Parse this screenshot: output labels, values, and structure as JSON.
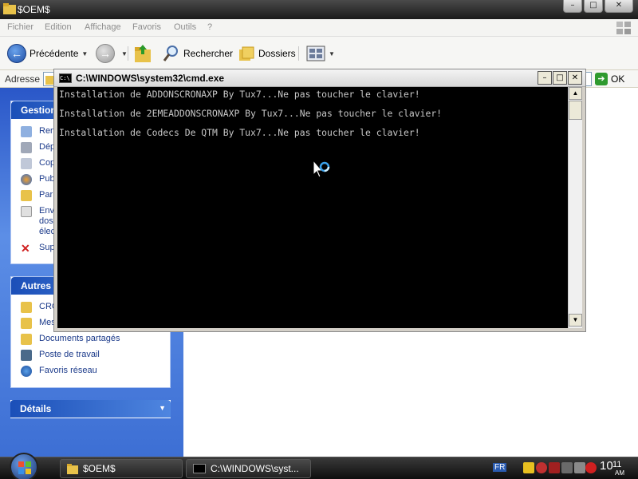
{
  "explorer": {
    "title": "$OEM$",
    "menu": [
      "Fichier",
      "Edition",
      "Affichage",
      "Favoris",
      "Outils",
      "?"
    ],
    "toolbar": {
      "back_label": "Précédente",
      "search_label": "Rechercher",
      "folders_label": "Dossiers"
    },
    "address": {
      "label": "Adresse",
      "go_label": "OK"
    },
    "sidepanel": {
      "box1": {
        "title": "Gestion",
        "items": [
          "Ren",
          "Dép",
          "Cop",
          "Pub",
          "Par",
          "Envoyer ce dossier par courrier électronique",
          "Sup"
        ],
        "item5_lines": [
          "Env",
          "dos",
          "élec"
        ]
      },
      "box2": {
        "title": "Autres",
        "items": [
          "CRO",
          "Mes",
          "Documents partagés",
          "Poste de travail",
          "Favoris réseau"
        ]
      },
      "box3": {
        "title": "Détails"
      }
    }
  },
  "cmd": {
    "title": "C:\\WINDOWS\\system32\\cmd.exe",
    "icon_text": "C:\\",
    "lines": [
      "Installation de ADDONSCRONAXP By Tux7...Ne pas toucher le clavier!",
      "Installation de 2EMEADDONSCRONAXP By Tux7...Ne pas toucher le clavier!",
      "Installation de Codecs De QTM By Tux7...Ne pas toucher le clavier!"
    ]
  },
  "taskbar": {
    "buttons": [
      "$OEM$",
      "C:\\WINDOWS\\syst..."
    ],
    "language": "FR",
    "clock": "10:11",
    "clock_hour": "10",
    "clock_min": "11",
    "ampm": "AM"
  },
  "colors": {
    "cmd_background": "#000000",
    "cmd_text": "#c8c8c8",
    "sidepanel_blue": "#3d6fd4",
    "taskbar": "#1a1a1a"
  }
}
